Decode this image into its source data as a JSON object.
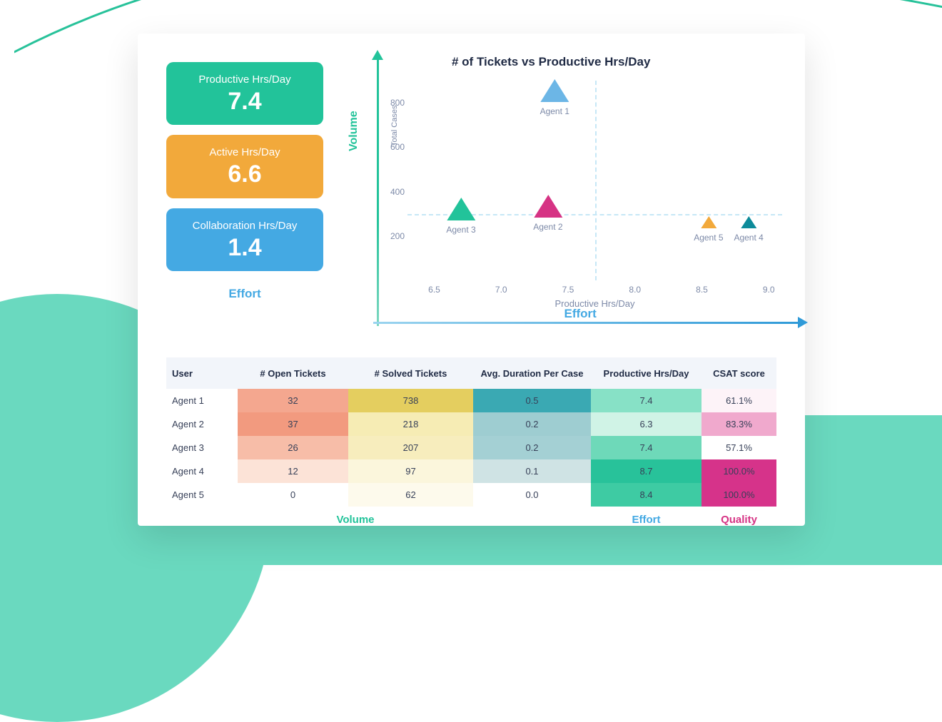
{
  "metrics": {
    "productive": {
      "label": "Productive Hrs/Day",
      "value": "7.4"
    },
    "active": {
      "label": "Active Hrs/Day",
      "value": "6.6"
    },
    "collab": {
      "label": "Collaboration Hrs/Day",
      "value": "1.4"
    },
    "effort_label": "Effort"
  },
  "chart": {
    "title": "# of Tickets vs Productive Hrs/Day",
    "volume_label": "Volume",
    "effort_label": "Effort",
    "y_axis_label": "Total Cases",
    "x_axis_label": "Productive Hrs/Day",
    "y_ticks": [
      "200",
      "400",
      "600",
      "800"
    ],
    "x_ticks": [
      "6.5",
      "7.0",
      "7.5",
      "8.0",
      "8.5",
      "9.0"
    ]
  },
  "chart_data": {
    "type": "scatter",
    "title": "# of Tickets vs Productive Hrs/Day",
    "xlabel": "Productive Hrs/Day",
    "ylabel": "Total Cases",
    "xlim": [
      6.3,
      9.1
    ],
    "ylim": [
      0,
      900
    ],
    "quadrant_lines": {
      "x": 7.7,
      "y": 300
    },
    "series": [
      {
        "name": "Agent 1",
        "x": 7.4,
        "y": 738,
        "color": "#6cb6e6",
        "size": "large"
      },
      {
        "name": "Agent 2",
        "x": 7.35,
        "y": 218,
        "color": "#d63384",
        "size": "large"
      },
      {
        "name": "Agent 3",
        "x": 6.7,
        "y": 207,
        "color": "#22c39a",
        "size": "large"
      },
      {
        "name": "Agent 4",
        "x": 8.85,
        "y": 170,
        "color": "#0d8b9a",
        "size": "small"
      },
      {
        "name": "Agent 5",
        "x": 8.55,
        "y": 170,
        "color": "#f2a93b",
        "size": "small"
      }
    ]
  },
  "table": {
    "headers": [
      "User",
      "# Open Tickets",
      "# Solved Tickets",
      "Avg. Duration Per Case",
      "Productive Hrs/Day",
      "CSAT score"
    ],
    "group_labels": {
      "volume": "Volume",
      "effort": "Effort",
      "quality": "Quality"
    },
    "rows": [
      {
        "user": "Agent 1",
        "open": "32",
        "solved": "738",
        "avg": "0.5",
        "prod": "7.4",
        "csat": "61.1%",
        "c": {
          "open": "#f4a78f",
          "solved": "#e4ce5f",
          "avg": "#3aa9b3",
          "prod": "#87e1c6",
          "csat": "#fdf3f8"
        }
      },
      {
        "user": "Agent 2",
        "open": "37",
        "solved": "218",
        "avg": "0.2",
        "prod": "6.3",
        "csat": "83.3%",
        "c": {
          "open": "#f29a7f",
          "solved": "#f6ecb4",
          "avg": "#9ecdd1",
          "prod": "#d0f3e6",
          "csat": "#f0a9cd"
        }
      },
      {
        "user": "Agent 3",
        "open": "26",
        "solved": "207",
        "avg": "0.2",
        "prod": "7.4",
        "csat": "57.1%",
        "c": {
          "open": "#f7bda8",
          "solved": "#f7edbd",
          "avg": "#a4d0d4",
          "prod": "#6ed9b9",
          "csat": "#ffffff"
        }
      },
      {
        "user": "Agent 4",
        "open": "12",
        "solved": "97",
        "avg": "0.1",
        "prod": "8.7",
        "csat": "100.0%",
        "c": {
          "open": "#fce3d7",
          "solved": "#fbf6dc",
          "avg": "#cfe3e4",
          "prod": "#28c29a",
          "csat": "#d6338a"
        }
      },
      {
        "user": "Agent 5",
        "open": "0",
        "solved": "62",
        "avg": "0.0",
        "prod": "8.4",
        "csat": "100.0%",
        "c": {
          "open": "#ffffff",
          "solved": "#fdfaec",
          "avg": "#ffffff",
          "prod": "#3ecba3",
          "csat": "#d6338a"
        }
      }
    ]
  }
}
